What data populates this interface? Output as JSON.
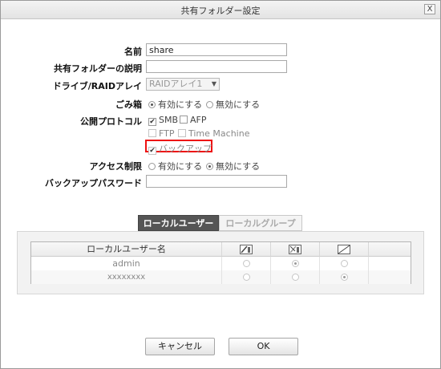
{
  "dialog": {
    "title": "共有フォルダー設定",
    "close_label": "X"
  },
  "form": {
    "name_label": "名前",
    "name_value": "share",
    "description_label": "共有フォルダーの説明",
    "description_value": "",
    "drive_label": "ドライブ/RAIDアレイ",
    "drive_value": "RAIDアレイ1",
    "trash_label": "ごみ箱",
    "trash_enabled_label": "有効にする",
    "trash_disabled_label": "無効にする",
    "trash_selected": "enabled",
    "protocol_label": "公開プロトコル",
    "protocols": [
      {
        "label": "SMB",
        "checked": true,
        "enabled": true
      },
      {
        "label": "AFP",
        "checked": false,
        "enabled": true
      },
      {
        "label": "FTP",
        "checked": false,
        "enabled": false
      },
      {
        "label": "Time Machine",
        "checked": false,
        "enabled": false
      },
      {
        "label": "バックアップ",
        "checked": true,
        "enabled": false,
        "highlighted": true
      }
    ],
    "access_label": "アクセス制限",
    "access_enabled_label": "有効にする",
    "access_disabled_label": "無効にする",
    "access_selected": "disabled",
    "backup_password_label": "バックアップパスワード",
    "backup_password_value": ""
  },
  "tabs": [
    {
      "label": "ローカルユーザー",
      "active": true
    },
    {
      "label": "ローカルグループ",
      "active": false
    }
  ],
  "user_table": {
    "columns": [
      "ローカルユーザー名",
      "read-write-icon",
      "read-only-icon",
      "no-access-icon"
    ],
    "rows": [
      {
        "name": "admin",
        "selected": "read-only"
      },
      {
        "name": "xxxxxxxx",
        "selected": "no-access"
      }
    ]
  },
  "buttons": {
    "cancel": "キャンセル",
    "ok": "OK"
  }
}
